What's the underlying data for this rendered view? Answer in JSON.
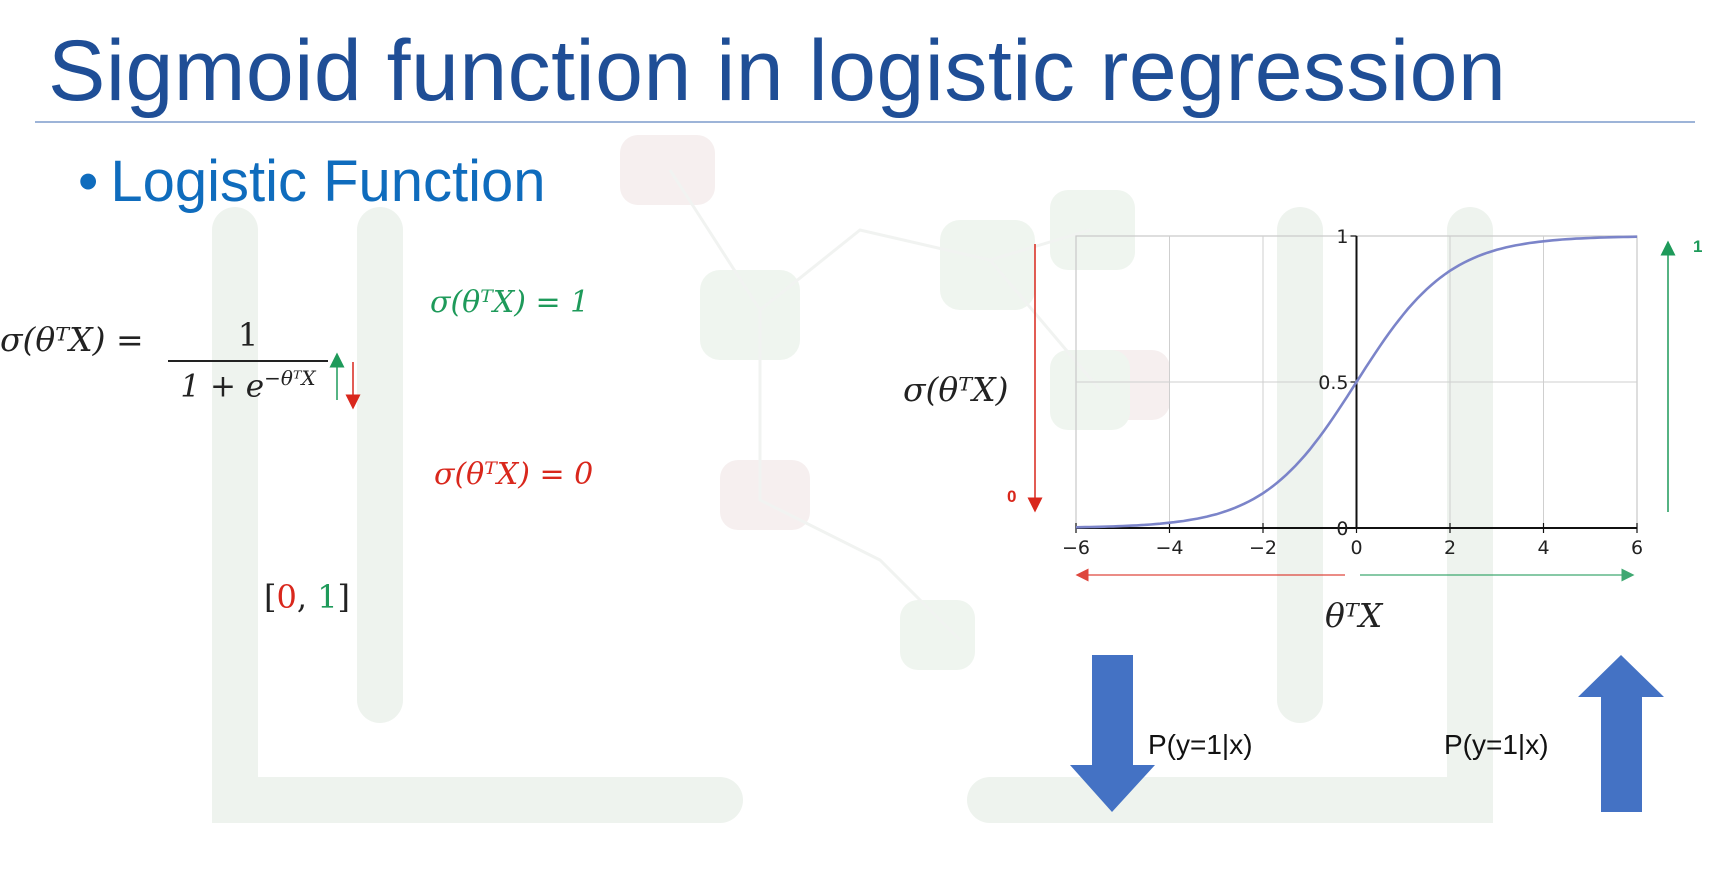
{
  "slide": {
    "title": "Sigmoid function in logistic regression",
    "bullet": "Logistic Function",
    "formula": {
      "lhs": "σ(θᵀX) =",
      "numerator": "1",
      "denominator": "1 + e",
      "exponent": "−θᵀX"
    },
    "sigma_one": "σ(θᵀX) = 1",
    "sigma_zero": "σ(θᵀX) = 0",
    "range": {
      "open": "[",
      "zero": "0",
      "sep": ", ",
      "one": "1",
      "close": "]"
    },
    "chart_ylabel": "σ(θᵀX)",
    "chart_xlabel": "θᵀX",
    "label_zero": "0",
    "label_one": "1",
    "prob_left": "P(y=1|x)",
    "prob_right": "P(y=1|x)"
  },
  "colors": {
    "title": "#1f4e96",
    "bullet": "#0f6cbd",
    "green": "#1e9a5a",
    "red": "#d9271c",
    "curve": "#7b84c9",
    "arrow_blue": "#4472c4"
  },
  "chart_data": {
    "type": "line",
    "function": "sigmoid",
    "x": [
      -6,
      -5,
      -4,
      -3,
      -2,
      -1,
      0,
      1,
      2,
      3,
      4,
      5,
      6
    ],
    "series": [
      {
        "values": [
          0.0025,
          0.0067,
          0.018,
          0.047,
          0.119,
          0.269,
          0.5,
          0.731,
          0.881,
          0.953,
          0.982,
          0.9933,
          0.9975
        ]
      }
    ],
    "xlim": [
      -6,
      6
    ],
    "ylim": [
      0,
      1
    ],
    "xticks": [
      -6,
      -4,
      -2,
      0,
      2,
      4,
      6
    ],
    "xtick_labels": [
      "−6",
      "−4",
      "−2",
      "0",
      "2",
      "4",
      "6"
    ],
    "yticks": [
      0,
      0.5,
      1
    ],
    "ytick_labels": [
      "0",
      "0.5",
      "1"
    ],
    "grid": true
  }
}
